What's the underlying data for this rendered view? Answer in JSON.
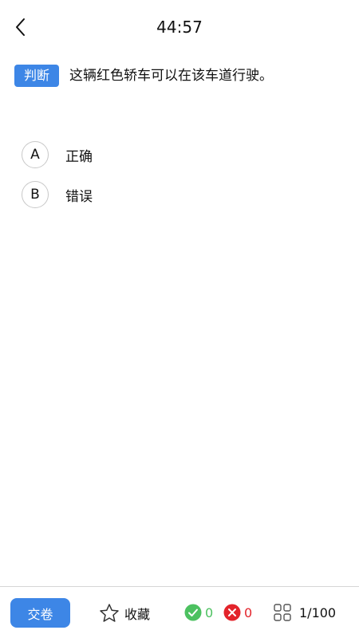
{
  "header": {
    "timer": "44:57"
  },
  "question": {
    "type_label": "判断",
    "text": "这辆红色轿车可以在该车道行驶。"
  },
  "options": [
    {
      "letter": "A",
      "text": "正确"
    },
    {
      "letter": "B",
      "text": "错误"
    }
  ],
  "bottom_bar": {
    "submit_label": "交卷",
    "favorite_label": "收藏",
    "correct_count": "0",
    "wrong_count": "0",
    "progress": "1/100"
  },
  "colors": {
    "accent": "#3d86e6",
    "correct": "#4cc160",
    "wrong": "#e3242b"
  },
  "icons": [
    "back-arrow-icon",
    "star-icon",
    "check-circle-icon",
    "x-circle-icon",
    "grid-icon"
  ]
}
